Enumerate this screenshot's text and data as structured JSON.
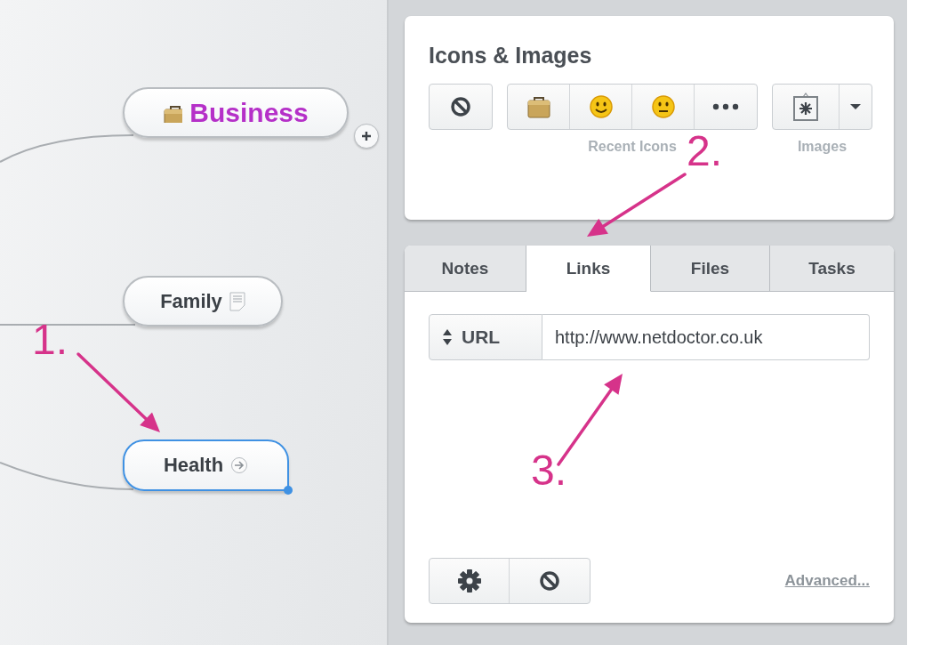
{
  "mind_map": {
    "nodes": [
      {
        "label": "Business",
        "color": "#b530c8",
        "selected": false,
        "has_children": true
      },
      {
        "label": "Family",
        "color": "#3b4046",
        "selected": false,
        "has_children": false
      },
      {
        "label": "Health",
        "color": "#3b4046",
        "selected": true,
        "has_children": false
      }
    ]
  },
  "icons_images": {
    "title": "Icons & Images",
    "recent_label": "Recent Icons",
    "images_label": "Images"
  },
  "tabs": [
    {
      "label": "Notes",
      "selected": false
    },
    {
      "label": "Links",
      "selected": true
    },
    {
      "label": "Files",
      "selected": false
    },
    {
      "label": "Tasks",
      "selected": false
    }
  ],
  "link": {
    "type_label": "URL",
    "value": "http://www.netdoctor.co.uk"
  },
  "footer": {
    "advanced_link": "Advanced..."
  },
  "annotations": [
    {
      "label": "1."
    },
    {
      "label": "2."
    },
    {
      "label": "3."
    }
  ]
}
